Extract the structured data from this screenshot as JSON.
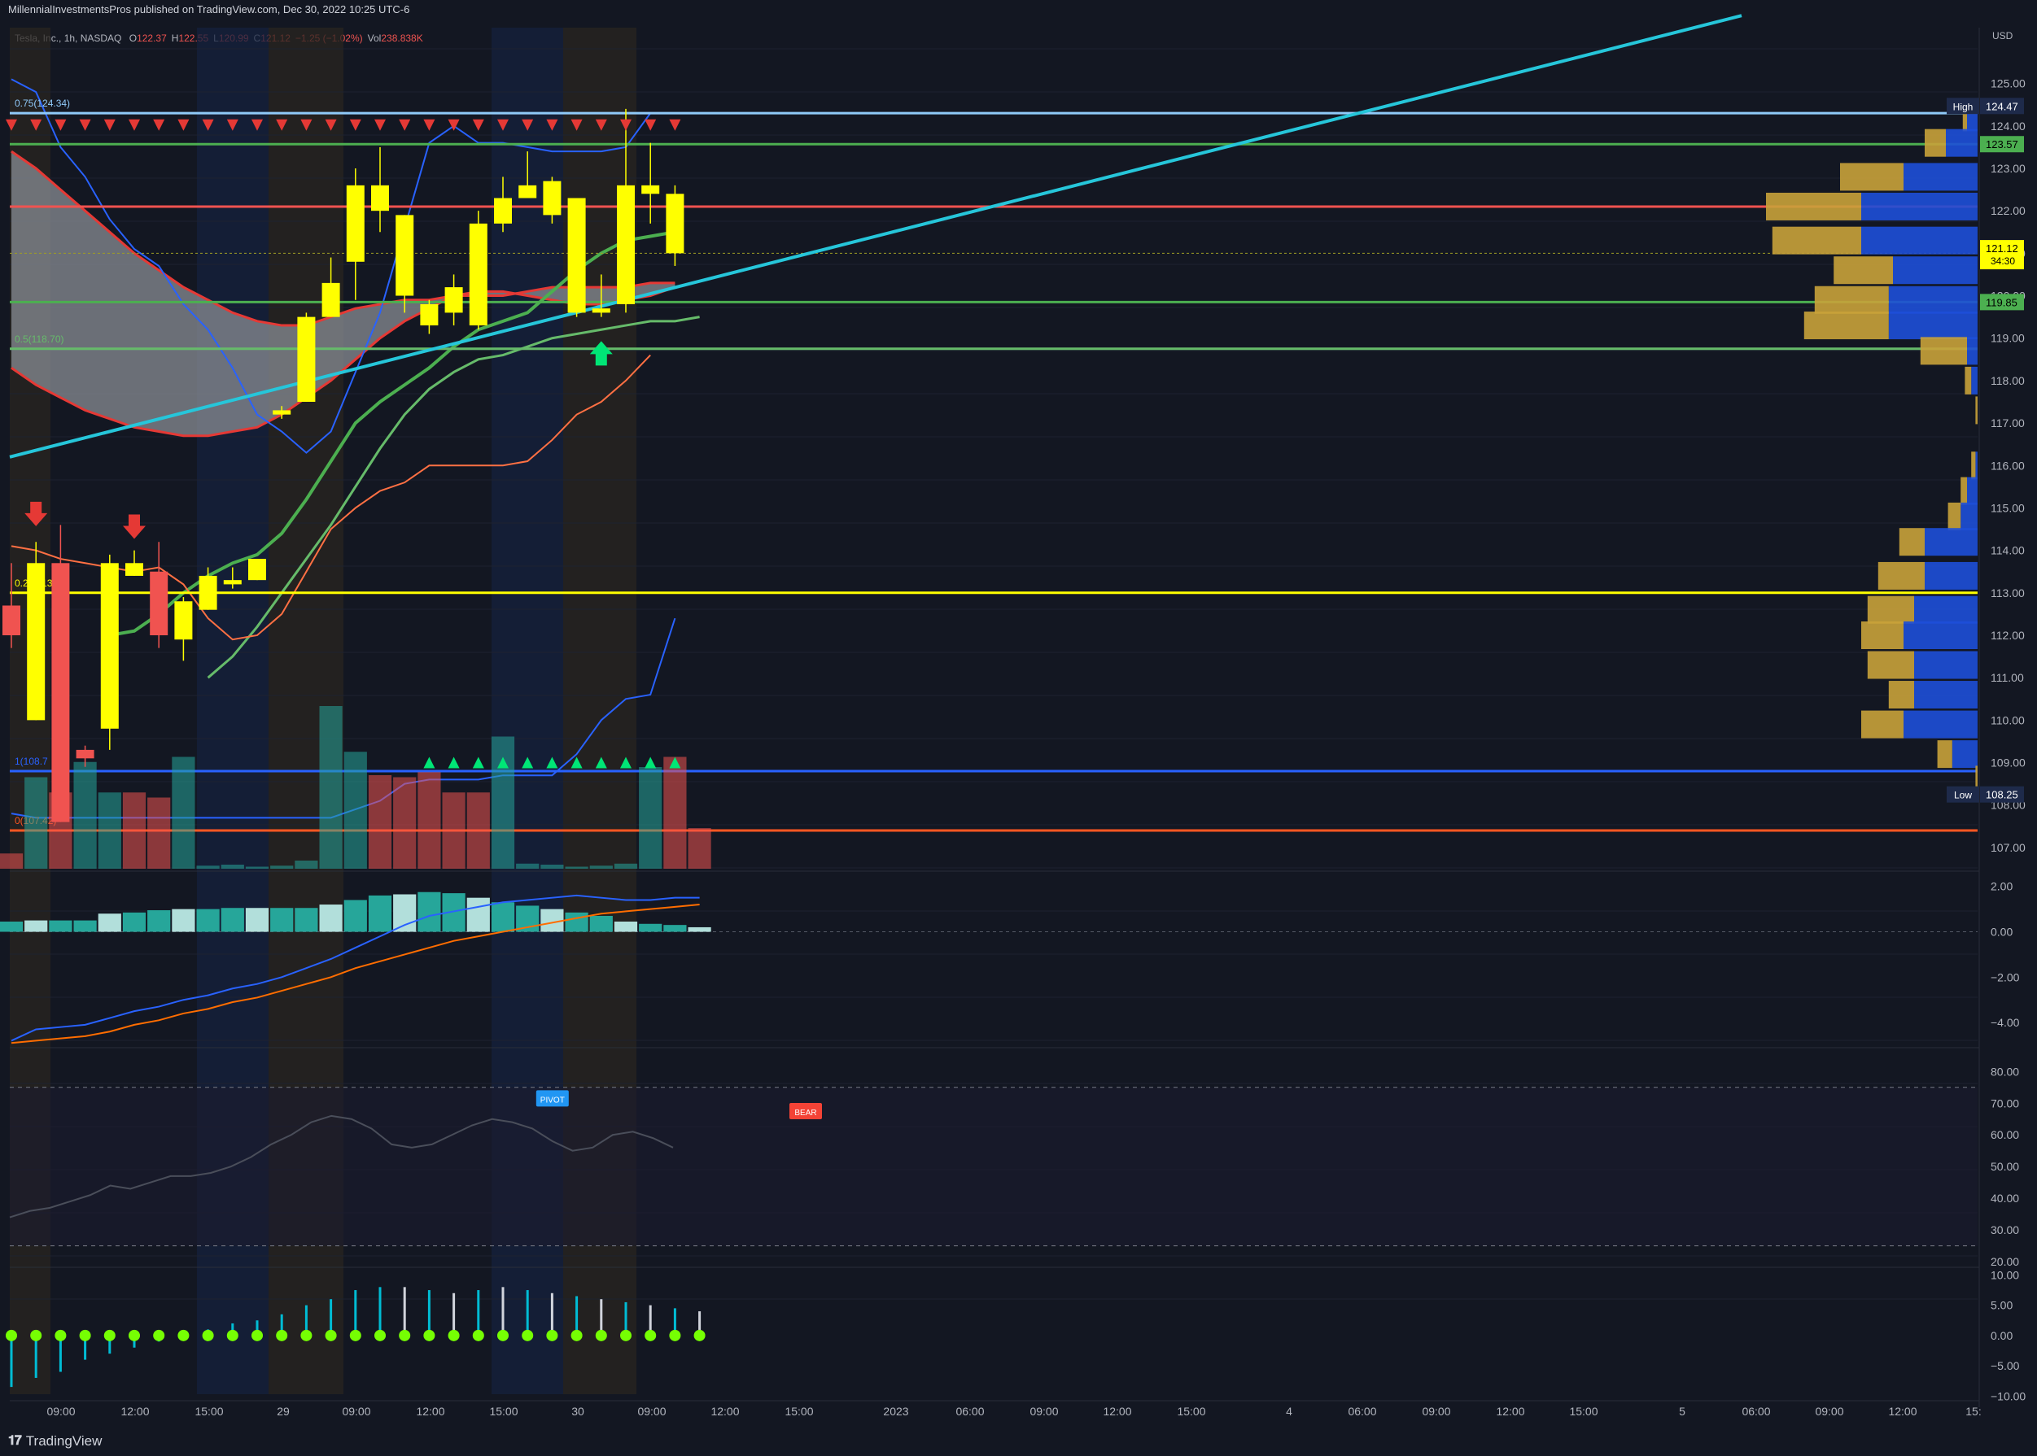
{
  "header": {
    "published": "MillennialInvestmentsPros published on TradingView.com, Dec 30, 2022 10:25 UTC-6",
    "symbol": "Tesla, Inc., 1h, NASDAQ",
    "ohlc": [
      {
        "k": "O",
        "v": "122.37"
      },
      {
        "k": "H",
        "v": "122.55"
      },
      {
        "k": "L",
        "v": "120.99"
      },
      {
        "k": "C",
        "v": "121.12"
      },
      {
        "k": "",
        "v": "−1.25 (−1.02%)"
      },
      {
        "k": "Vol",
        "v": "238.838K"
      }
    ]
  },
  "footer": {
    "brand": "TradingView"
  },
  "colors": {
    "bg": "#131722",
    "yellow": "#ffff00",
    "red": "#f05350",
    "green": "#4caf50",
    "teal": "#00bcd4",
    "blue": "#2962ff",
    "orange": "#ff5722",
    "gold": "#c9a23a"
  },
  "chart_data": [
    {
      "type": "candlestick",
      "title": "Tesla, Inc., 1h, NASDAQ",
      "currency": "USD",
      "ylim": [
        106.5,
        126.2
      ],
      "y_ticks": [
        "125.00",
        "124.00",
        "123.00",
        "122.00",
        "121.00",
        "120.00",
        "119.00",
        "118.00",
        "117.00",
        "116.00",
        "115.00",
        "114.00",
        "113.00",
        "112.00",
        "111.00",
        "110.00",
        "109.00",
        "108.00",
        "107.00"
      ],
      "x_ticks": [
        "09:00",
        "12:00",
        "15:00",
        "29",
        "09:00",
        "12:00",
        "15:00",
        "30",
        "09:00",
        "12:00",
        "15:00",
        "2023",
        "06:00",
        "09:00",
        "12:00",
        "15:00",
        "4",
        "06:00",
        "09:00",
        "12:00",
        "15:00",
        "5",
        "06:00",
        "09:00",
        "12:00",
        "15:"
      ],
      "candles": [
        {
          "o": 112.7,
          "h": 113.7,
          "l": 111.7,
          "c": 112.0,
          "dir": "down"
        },
        {
          "o": 113.7,
          "h": 114.2,
          "l": 110.0,
          "c": 110.0,
          "dir": "up"
        },
        {
          "o": 113.7,
          "h": 114.6,
          "l": 107.6,
          "c": 107.6,
          "dir": "down"
        },
        {
          "o": 109.3,
          "h": 109.4,
          "l": 108.9,
          "c": 109.1,
          "dir": "down"
        },
        {
          "o": 109.8,
          "h": 113.9,
          "l": 109.3,
          "c": 113.7,
          "dir": "up"
        },
        {
          "o": 113.4,
          "h": 114.0,
          "l": 113.4,
          "c": 113.7,
          "dir": "up"
        },
        {
          "o": 113.5,
          "h": 114.2,
          "l": 111.7,
          "c": 112.0,
          "dir": "down"
        },
        {
          "o": 111.9,
          "h": 112.9,
          "l": 111.4,
          "c": 112.8,
          "dir": "up"
        },
        {
          "o": 112.6,
          "h": 113.6,
          "l": 112.6,
          "c": 113.4,
          "dir": "up"
        },
        {
          "o": 113.2,
          "h": 113.6,
          "l": 113.1,
          "c": 113.3,
          "dir": "up"
        },
        {
          "o": 113.3,
          "h": 113.8,
          "l": 113.3,
          "c": 113.8,
          "dir": "up"
        },
        {
          "o": 117.2,
          "h": 117.4,
          "l": 117.1,
          "c": 117.3,
          "dir": "up"
        },
        {
          "o": 117.5,
          "h": 119.6,
          "l": 117.5,
          "c": 119.5,
          "dir": "up"
        },
        {
          "o": 119.5,
          "h": 120.9,
          "l": 119.5,
          "c": 120.3,
          "dir": "up"
        },
        {
          "o": 120.8,
          "h": 123.0,
          "l": 119.9,
          "c": 122.6,
          "dir": "up"
        },
        {
          "o": 122.0,
          "h": 123.5,
          "l": 121.5,
          "c": 122.6,
          "dir": "up"
        },
        {
          "o": 120.0,
          "h": 121.9,
          "l": 119.6,
          "c": 121.9,
          "dir": "up"
        },
        {
          "o": 119.3,
          "h": 119.9,
          "l": 119.1,
          "c": 119.8,
          "dir": "up"
        },
        {
          "o": 119.6,
          "h": 120.5,
          "l": 119.3,
          "c": 120.2,
          "dir": "up"
        },
        {
          "o": 119.3,
          "h": 122.0,
          "l": 119.2,
          "c": 121.7,
          "dir": "up"
        },
        {
          "o": 121.7,
          "h": 122.8,
          "l": 121.5,
          "c": 122.3,
          "dir": "up"
        },
        {
          "o": 122.3,
          "h": 123.4,
          "l": 122.3,
          "c": 122.6,
          "dir": "up"
        },
        {
          "o": 121.9,
          "h": 122.8,
          "l": 121.7,
          "c": 122.7,
          "dir": "up"
        },
        {
          "o": 119.6,
          "h": 122.2,
          "l": 119.5,
          "c": 122.3,
          "dir": "up"
        },
        {
          "o": 119.6,
          "h": 120.5,
          "l": 119.5,
          "c": 119.7,
          "dir": "up"
        },
        {
          "o": 119.8,
          "h": 124.4,
          "l": 119.6,
          "c": 122.6,
          "dir": "up"
        },
        {
          "o": 122.4,
          "h": 123.6,
          "l": 121.7,
          "c": 122.6,
          "dir": "up"
        },
        {
          "o": 121.0,
          "h": 122.6,
          "l": 120.7,
          "c": 122.4,
          "dir": "up"
        }
      ],
      "volume": [
        {
          "v": 0.15,
          "dir": "down"
        },
        {
          "v": 0.9,
          "dir": "up"
        },
        {
          "v": 0.75,
          "dir": "down"
        },
        {
          "v": 1.05,
          "dir": "up"
        },
        {
          "v": 0.75,
          "dir": "up"
        },
        {
          "v": 0.75,
          "dir": "down"
        },
        {
          "v": 0.7,
          "dir": "down"
        },
        {
          "v": 1.1,
          "dir": "up"
        },
        {
          "v": 0.03,
          "dir": "up"
        },
        {
          "v": 0.04,
          "dir": "up"
        },
        {
          "v": 0.02,
          "dir": "up"
        },
        {
          "v": 0.03,
          "dir": "up"
        },
        {
          "v": 0.08,
          "dir": "up"
        },
        {
          "v": 1.6,
          "dir": "up"
        },
        {
          "v": 1.15,
          "dir": "up"
        },
        {
          "v": 0.92,
          "dir": "down"
        },
        {
          "v": 0.9,
          "dir": "down"
        },
        {
          "v": 0.95,
          "dir": "down"
        },
        {
          "v": 0.75,
          "dir": "down"
        },
        {
          "v": 0.75,
          "dir": "down"
        },
        {
          "v": 1.3,
          "dir": "up"
        },
        {
          "v": 0.05,
          "dir": "up"
        },
        {
          "v": 0.04,
          "dir": "up"
        },
        {
          "v": 0.02,
          "dir": "up"
        },
        {
          "v": 0.03,
          "dir": "up"
        },
        {
          "v": 0.05,
          "dir": "up"
        },
        {
          "v": 1.0,
          "dir": "up"
        },
        {
          "v": 1.1,
          "dir": "down"
        },
        {
          "v": 0.4,
          "dir": "down"
        }
      ],
      "horizontal_levels": [
        {
          "price": 124.3,
          "color": "#90caf9",
          "label": "0.75(124.34)"
        },
        {
          "price": 123.57,
          "color": "#4caf50",
          "tag": "123.57"
        },
        {
          "price": 122.1,
          "color": "#f05350"
        },
        {
          "price": 121.0,
          "color": "#9e9d24",
          "dashed": true
        },
        {
          "price": 119.85,
          "color": "#4caf50",
          "tag": "119.85"
        },
        {
          "price": 118.75,
          "color": "#66bb6a",
          "label": "0.5(118.70)"
        },
        {
          "price": 113.0,
          "color": "#ffff00",
          "label": "0.25(113.0"
        },
        {
          "price": 108.8,
          "color": "#2962ff",
          "label": "1(108.7"
        },
        {
          "price": 107.4,
          "color": "#ff5722",
          "label": "0(107.42)"
        }
      ],
      "price_tags": [
        {
          "label": "High",
          "value": "124.47",
          "price": 124.47
        },
        {
          "label": "",
          "value": "123.57",
          "price": 123.57,
          "color": "#4caf50"
        },
        {
          "label": "",
          "value": "121.12",
          "sub": "34:30",
          "price": 121.12,
          "color": "#ffff00"
        },
        {
          "label": "",
          "value": "119.85",
          "price": 119.85,
          "color": "#4caf50"
        },
        {
          "label": "Low",
          "value": "108.25",
          "price": 108.25
        }
      ],
      "trendline": {
        "start_price": 116.2,
        "end_price": 126.6,
        "color": "#26c6da"
      },
      "signals": [
        {
          "type": "sell-arrow",
          "bar": 1,
          "price": 114.8
        },
        {
          "type": "sell-arrow",
          "bar": 5,
          "price": 114.5
        },
        {
          "type": "buy-arrow",
          "bar": 24,
          "price": 118.7
        }
      ],
      "volume_profile": [
        {
          "price": 124.2,
          "buy": 0.05,
          "sell": 0.02
        },
        {
          "price": 123.6,
          "buy": 0.15,
          "sell": 0.1
        },
        {
          "price": 122.8,
          "buy": 0.35,
          "sell": 0.3
        },
        {
          "price": 122.1,
          "buy": 0.55,
          "sell": 0.45
        },
        {
          "price": 121.3,
          "buy": 0.55,
          "sell": 0.42
        },
        {
          "price": 120.6,
          "buy": 0.4,
          "sell": 0.28
        },
        {
          "price": 119.9,
          "buy": 0.42,
          "sell": 0.35
        },
        {
          "price": 119.3,
          "buy": 0.42,
          "sell": 0.4
        },
        {
          "price": 118.7,
          "buy": 0.05,
          "sell": 0.22
        },
        {
          "price": 118.0,
          "buy": 0.03,
          "sell": 0.03
        },
        {
          "price": 117.3,
          "buy": 0.0,
          "sell": 0.01
        },
        {
          "price": 116.0,
          "buy": 0.01,
          "sell": 0.02
        },
        {
          "price": 115.4,
          "buy": 0.05,
          "sell": 0.03
        },
        {
          "price": 114.8,
          "buy": 0.08,
          "sell": 0.06
        },
        {
          "price": 114.2,
          "buy": 0.25,
          "sell": 0.12
        },
        {
          "price": 113.4,
          "buy": 0.25,
          "sell": 0.22
        },
        {
          "price": 112.6,
          "buy": 0.3,
          "sell": 0.22
        },
        {
          "price": 112.0,
          "buy": 0.35,
          "sell": 0.2
        },
        {
          "price": 111.3,
          "buy": 0.3,
          "sell": 0.22
        },
        {
          "price": 110.6,
          "buy": 0.3,
          "sell": 0.12
        },
        {
          "price": 109.9,
          "buy": 0.35,
          "sell": 0.2
        },
        {
          "price": 109.2,
          "buy": 0.12,
          "sell": 0.07
        },
        {
          "price": 108.6,
          "buy": 0.0,
          "sell": 0.01
        }
      ]
    },
    {
      "type": "bar+line",
      "title": "MACD",
      "ylim": [
        -5,
        2.6
      ],
      "y_ticks": [
        "2.00",
        "0.00",
        "−2.00",
        "−4.00"
      ],
      "hist": [
        0.45,
        0.5,
        0.5,
        0.5,
        0.8,
        0.85,
        0.95,
        1.0,
        1.0,
        1.05,
        1.05,
        1.05,
        1.05,
        1.2,
        1.4,
        1.6,
        1.65,
        1.75,
        1.7,
        1.5,
        1.3,
        1.15,
        1.0,
        0.85,
        0.7,
        0.45,
        0.35,
        0.3,
        0.2
      ],
      "macd": [
        -4.8,
        -4.3,
        -4.2,
        -4.1,
        -3.8,
        -3.5,
        -3.3,
        -3.0,
        -2.8,
        -2.5,
        -2.3,
        -2.0,
        -1.6,
        -1.2,
        -0.7,
        -0.2,
        0.3,
        0.7,
        0.9,
        1.1,
        1.3,
        1.4,
        1.5,
        1.6,
        1.5,
        1.4,
        1.4,
        1.5,
        1.5
      ],
      "signal": [
        -4.9,
        -4.8,
        -4.7,
        -4.6,
        -4.4,
        -4.1,
        -3.9,
        -3.6,
        -3.4,
        -3.1,
        -2.9,
        -2.6,
        -2.3,
        -2.0,
        -1.6,
        -1.3,
        -1.0,
        -0.7,
        -0.4,
        -0.2,
        0.0,
        0.2,
        0.4,
        0.6,
        0.8,
        0.9,
        1.0,
        1.1,
        1.2
      ]
    },
    {
      "type": "line",
      "title": "RSI",
      "ylim": [
        19,
        87
      ],
      "y_ticks": [
        "80.00",
        "70.00",
        "60.00",
        "50.00",
        "40.00",
        "30.00",
        "20.00"
      ],
      "values": [
        34,
        36,
        37,
        39,
        41,
        44,
        43,
        45,
        47,
        47,
        48,
        50,
        53,
        57,
        60,
        64,
        66,
        65,
        62,
        57,
        56,
        57,
        60,
        63,
        65,
        64,
        62,
        58,
        55,
        56,
        60,
        61,
        59,
        56
      ],
      "labels": [
        {
          "text": "PIVOT",
          "index": 15,
          "value": 71
        },
        {
          "text": "BEAR",
          "index": 22,
          "value": 67
        }
      ]
    },
    {
      "type": "bar",
      "title": "Momentum",
      "ylim": [
        -10.5,
        11
      ],
      "y_ticks": [
        "10.00",
        "5.00",
        "0.00",
        "−5.00",
        "−10.00"
      ],
      "values": [
        -8.5,
        -7,
        -6,
        -4,
        -3,
        -2,
        -1,
        0,
        1,
        2,
        2.5,
        3.5,
        5,
        6,
        7.5,
        8,
        8,
        7.5,
        7,
        7.5,
        8,
        7.5,
        7,
        6.5,
        6,
        5.5,
        5,
        4.5,
        4
      ]
    }
  ]
}
